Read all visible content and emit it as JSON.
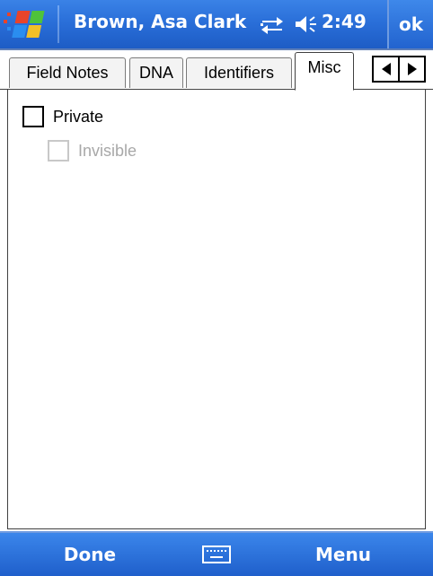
{
  "titlebar": {
    "title": "Brown, Asa Clark",
    "time": "2:49",
    "ok_label": "ok",
    "start_icon": "windows-flag-icon",
    "connectivity_icon": "connectivity-arrows-icon",
    "volume_icon": "speaker-icon"
  },
  "tabs": [
    {
      "label": "Field Notes",
      "active": false
    },
    {
      "label": "DNA",
      "active": false
    },
    {
      "label": "Identifiers",
      "active": false
    },
    {
      "label": "Misc",
      "active": true
    }
  ],
  "tab_scroll": {
    "left_icon": "arrow-left-icon",
    "right_icon": "arrow-right-icon"
  },
  "misc": {
    "private": {
      "label": "Private",
      "checked": false,
      "enabled": true
    },
    "invisible": {
      "label": "Invisible",
      "checked": false,
      "enabled": false
    }
  },
  "softkeys": {
    "left": "Done",
    "right": "Menu",
    "keyboard_icon": "keyboard-icon"
  },
  "colors": {
    "bar_blue": "#2a6fd9",
    "text_white": "#ffffff",
    "disabled_gray": "#a8a8a8"
  }
}
